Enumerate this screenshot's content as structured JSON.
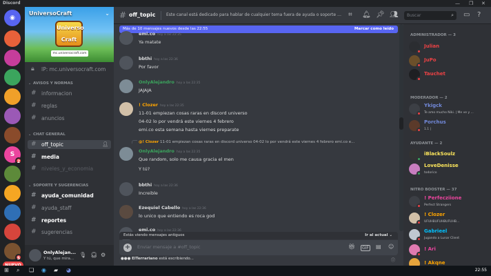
{
  "window": {
    "title": "Discord",
    "controls": [
      "—",
      "❐",
      "✕"
    ]
  },
  "servers": {
    "items": [
      {
        "name": "home",
        "color": "#5865f2",
        "glyph": "◉"
      },
      {
        "name": "server-1",
        "color": "#e8613a",
        "glyph": ""
      },
      {
        "name": "server-2",
        "color": "#c63d9b",
        "glyph": ""
      },
      {
        "name": "server-3",
        "color": "#3ba55d",
        "glyph": ""
      },
      {
        "name": "server-4",
        "color": "#f0a029",
        "glyph": ""
      },
      {
        "name": "server-5",
        "color": "#9b59b6",
        "glyph": ""
      },
      {
        "name": "server-6",
        "color": "#8a4b2b",
        "glyph": ""
      },
      {
        "name": "server-7",
        "color": "#eb459e",
        "glyph": "S",
        "badge": "2"
      },
      {
        "name": "server-8",
        "color": "#5d8a3a",
        "glyph": ""
      },
      {
        "name": "server-9",
        "color": "#f5a623",
        "glyph": ""
      },
      {
        "name": "server-10",
        "color": "#2f6fb5",
        "glyph": ""
      },
      {
        "name": "server-11",
        "color": "#d6453c",
        "glyph": ""
      },
      {
        "name": "server-12",
        "color": "#7a5230",
        "glyph": "",
        "badge": "5"
      }
    ],
    "new_label": "NUEVO"
  },
  "sidebar": {
    "server_name": "UniversoCraft",
    "banner_logo": "Universo Craft",
    "banner_url": "mc.universocraft.com",
    "channels_top": [
      {
        "label": "IP: mc.universocraft.com",
        "icon": "lock-icon"
      }
    ],
    "cat1": "AVISOS Y NORMAS",
    "cat1_channels": [
      "informacion",
      "reglas",
      "anuncios"
    ],
    "cat2": "CHAT GENERAL",
    "cat2_channels": [
      "off_topic",
      "media",
      "niveles_y_economia"
    ],
    "cat3": "SOPORTE Y SUGERENCIAS",
    "cat3_channels": [
      "ayuda_comunidad",
      "ayuda_staff",
      "reportes",
      "sugerencias"
    ]
  },
  "user": {
    "name": "OnlyAlejan...",
    "status": "Y tú, que mira..."
  },
  "header": {
    "channel": "off_topic",
    "topic": "Este canal está dedicado para hablar de cualquier tema fuera de ayuda o soporte d...",
    "search_placeholder": "Buscar"
  },
  "chat": {
    "new_messages": "Más de 10 mensajes nuevos desde las 22:55",
    "mark_read": "Marcar como leído",
    "messages": [
      {
        "author": "emi.co",
        "time": "hoy a las 22:35",
        "color": "#dcddde",
        "lines": [
          "Ya matate"
        ]
      },
      {
        "author": "bbthi",
        "time": "hoy a las 22:36",
        "color": "#dcddde",
        "lines": [
          "Por favor"
        ]
      },
      {
        "author": "OnlyAlejandro",
        "time": "hoy a las 22:35",
        "color": "#3ba55d",
        "lines": [
          "JAJAJA"
        ]
      },
      {
        "author": "! Clozer",
        "time": "hoy a las 22:35",
        "color": "#ffa500",
        "lines": [
          "11-01 empiezan cosas raras en discord universo",
          "04-02 lo por vendrá este viernes 4 febrero",
          "emi.co esta semana hasta viernes preparate"
        ]
      },
      {
        "author": "OnlyAlejandro",
        "time": "hoy a las 22:35",
        "color": "#3ba55d",
        "lines": [
          "Que random, solo me causa gracia el men",
          "Y tú?"
        ],
        "reply_author": "@! Clozer",
        "reply_text": "11-01 empiezan cosas raras en discord universo 04-02 lo por vendrá este viernes 4 febrero emi.co e..."
      },
      {
        "author": "bbthi",
        "time": "hoy a las 22:36",
        "color": "#dcddde",
        "lines": [
          "Increible"
        ]
      },
      {
        "author": "Ezequiel Cabello",
        "time": "hoy a las 22:36",
        "color": "#dcddde",
        "lines": [
          "lo unico que entiendo es roca god"
        ]
      },
      {
        "author": "emi.co",
        "time": "hoy a las 22:36",
        "color": "#dcddde",
        "lines": []
      }
    ],
    "old_messages": "Estás viendo mensajes antiguos",
    "jump_present": "Ir al actual",
    "composer_placeholder": "Enviar mensaje a #off_topic",
    "typing_user": "ElTerrariano",
    "typing_text": " está escribiendo..."
  },
  "members": {
    "cat_admin": "ADMINISTRADOR — 3",
    "admins": [
      {
        "name": "Julian",
        "color": "#ed4245",
        "avatar": "#2b2d31"
      },
      {
        "name": "JuPo",
        "color": "#ed4245",
        "avatar": "#6b4f2a"
      },
      {
        "name": "Tauchet",
        "color": "#ed4245",
        "avatar": "#1e1f22"
      }
    ],
    "cat_mod": "MODERADOR — 2",
    "mods": [
      {
        "name": "Ykigck",
        "sub": "Te amo mucho Niki. | Me ve y ...",
        "color": "#7289da",
        "avatar": "#3c3f45"
      },
      {
        "name": "Porchus",
        "sub": "1.1 |",
        "color": "#7289da",
        "avatar": "#5b3a2a"
      }
    ],
    "cat_helper": "AYUDANTE — 2",
    "helpers": [
      {
        "name": "iBlackSoulz",
        "color": "#fee75c",
        "avatar": "#333"
      },
      {
        "name": "LoveDenisse",
        "sub": "todorico",
        "color": "#fee75c",
        "avatar": "#c77dbf"
      }
    ],
    "cat_booster": "NITRO BOOSTER — 37",
    "boosters": [
      {
        "name": "! Perfecziione",
        "sub": "Perfect Strangers",
        "color": "#eb459e",
        "avatar": "#3c3f45"
      },
      {
        "name": "! Clozer",
        "sub": "UFUHBUFUHBUFUHB...",
        "color": "#ffa500",
        "avatar": "#d2c0a8"
      },
      {
        "name": "Gabrieel",
        "sub": "Jugando a Lunar Client",
        "color": "#00c2ff",
        "avatar": "#c0c8d0"
      },
      {
        "name": "! Ari",
        "sub": "",
        "color": "#eb459e",
        "avatar": "#e07ab0"
      },
      {
        "name": "! Akqne",
        "sub": "",
        "color": "#ffa500",
        "avatar": "#e6a43c"
      }
    ]
  },
  "taskbar": {
    "clock": "22:55"
  }
}
